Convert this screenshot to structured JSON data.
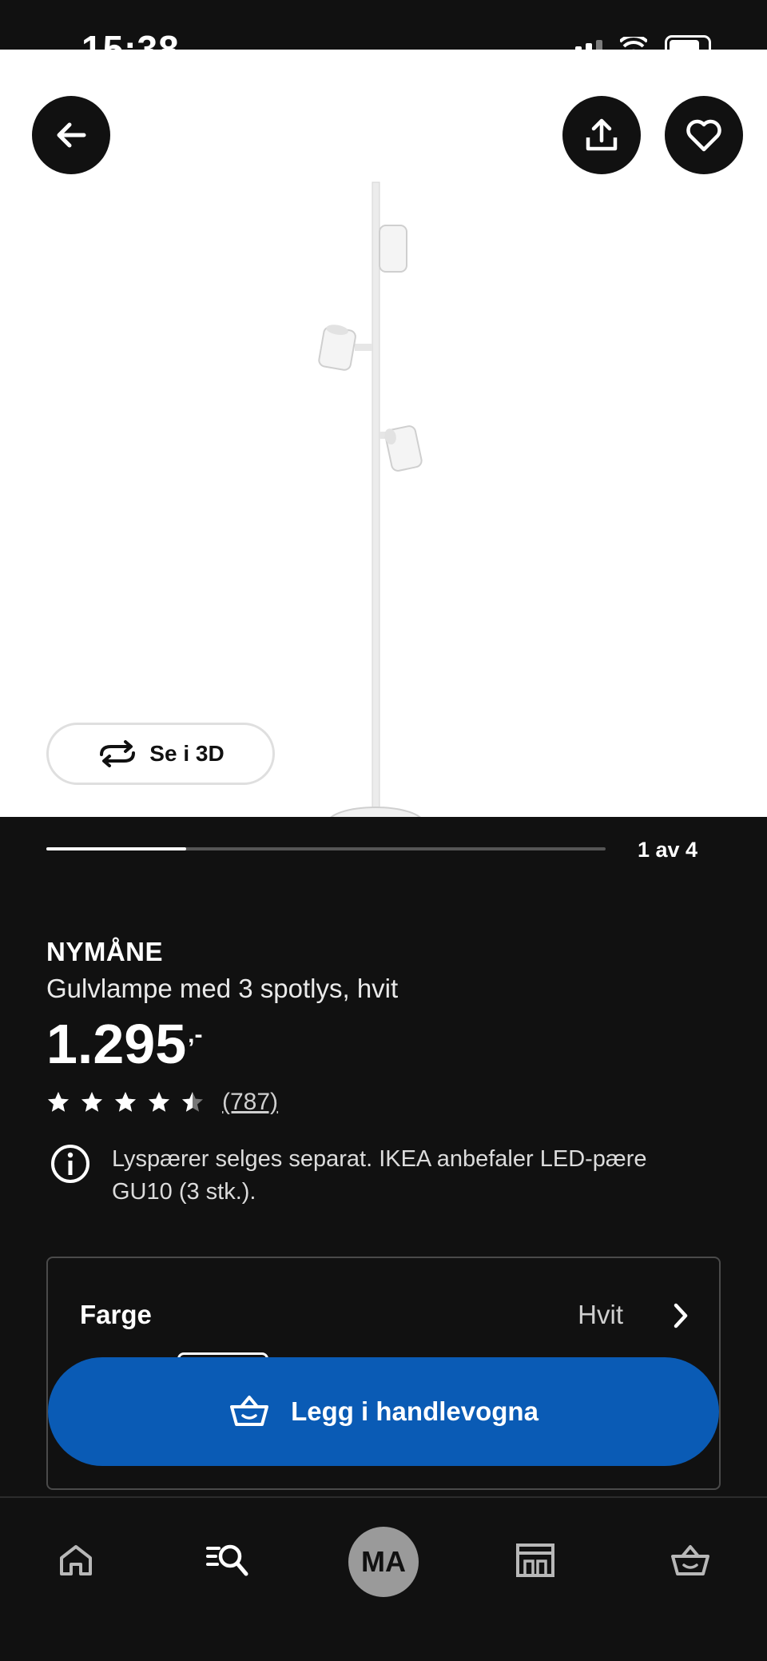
{
  "status_bar": {
    "time": "15:38"
  },
  "product": {
    "brand": "NYMÅNE",
    "description": "Gulvlampe med 3 spotlys, hvit",
    "price": "1.295",
    "price_suffix": ",-",
    "rating": 4.5,
    "rating_max": 5,
    "review_count": "(787)",
    "notice": "Lyspærer selges separat. IKEA anbefaler LED-pære GU10 (3 stk.)."
  },
  "gallery": {
    "see_3d_label": "Se i 3D",
    "pager": "1 av 4",
    "current": 1,
    "total": 4
  },
  "variant": {
    "label": "Farge",
    "value": "Hvit"
  },
  "cart": {
    "add_label": "Legg i handlevogna"
  },
  "nav": {
    "avatar_initials": "MA"
  },
  "icons": {
    "back": "arrow-left-icon",
    "share": "share-icon",
    "favorite": "heart-icon",
    "rotate": "rotate-3d-icon",
    "info": "info-icon",
    "chevron": "chevron-right-icon",
    "basket": "basket-icon",
    "home": "home-icon",
    "search": "search-icon",
    "store": "store-icon"
  },
  "colors": {
    "background": "#111111",
    "primary_button": "#0a5bb5"
  }
}
